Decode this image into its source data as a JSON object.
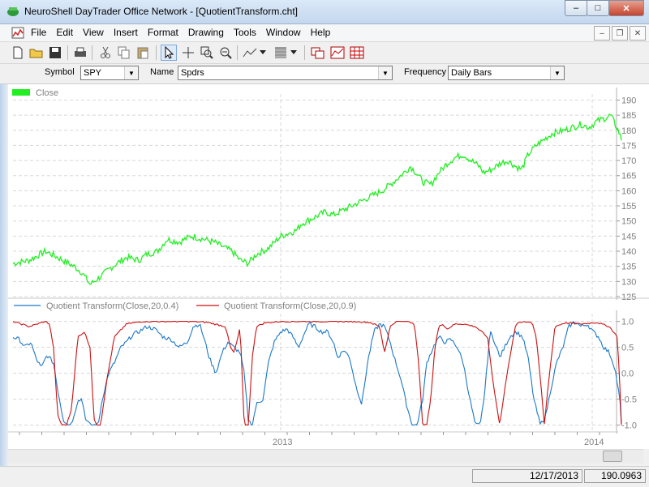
{
  "window": {
    "title": "NeuroShell DayTrader Office Network - [QuotientTransform.cht]",
    "buttons": {
      "minimize": "–",
      "maximize": "□",
      "close": "✕"
    }
  },
  "menu": {
    "items": [
      "File",
      "Edit",
      "View",
      "Insert",
      "Format",
      "Drawing",
      "Tools",
      "Window",
      "Help"
    ]
  },
  "toolbar": {
    "icons": [
      "new-icon",
      "open-icon",
      "save-icon",
      "print-icon",
      "cut-icon",
      "copy-icon",
      "paste-icon",
      "pointer-icon",
      "crosshair-icon",
      "zoom-in-icon",
      "zoom-out-icon",
      "line-tool-icon",
      "fill-pattern-icon",
      "chart-window-icon",
      "indicator-icon",
      "grid-icon"
    ]
  },
  "selectors": {
    "symbol_label": "Symbol",
    "symbol_value": "SPY",
    "name_label": "Name",
    "name_value": "Spdrs",
    "frequency_label": "Frequency",
    "frequency_value": "Daily Bars"
  },
  "status": {
    "date": "12/17/2013",
    "value": "190.0963"
  },
  "colors": {
    "price": "#22ee22",
    "qt1": "#1b78c8",
    "qt2": "#cc1111",
    "grid": "#d8d8d8"
  },
  "chart_data": [
    {
      "type": "line",
      "title": "",
      "series": [
        {
          "name": "Close",
          "anchors_x": [
            0,
            20,
            40,
            55,
            75,
            85,
            95,
            110,
            118,
            128,
            140,
            155,
            165,
            178,
            190,
            205,
            220,
            235,
            248,
            262,
            270,
            280,
            290,
            300,
            315,
            330,
            340,
            350,
            355,
            370,
            385,
            395,
            410,
            425,
            440,
            455,
            465,
            478,
            490,
            500,
            505,
            515,
            525,
            535,
            545,
            555,
            565,
            575,
            580,
            590,
            600,
            610,
            620,
            627,
            635,
            645,
            655,
            665,
            680,
            690,
            700,
            710,
            720,
            730,
            737,
            742,
            746,
            750
          ],
          "anchors_y": [
            136,
            137,
            140,
            138,
            135,
            133,
            129,
            132,
            134,
            136,
            138,
            137,
            139,
            140,
            144,
            143,
            145,
            144,
            143,
            141,
            140,
            137,
            136,
            139,
            141,
            145,
            146,
            147,
            149,
            151,
            153,
            152,
            154,
            156,
            158,
            160,
            162,
            165,
            168,
            165,
            163,
            162,
            166,
            169,
            171,
            172,
            170,
            168,
            166,
            167,
            169,
            170,
            168,
            167,
            172,
            175,
            177,
            179,
            180,
            181,
            182,
            181,
            183,
            184,
            185,
            182,
            180,
            177
          ]
        }
      ],
      "xlabel": "",
      "ylabel": "",
      "ylim": [
        125,
        192
      ],
      "yticks": [
        120,
        125,
        130,
        135,
        140,
        145,
        150,
        155,
        160,
        165,
        170,
        175,
        180,
        185,
        190
      ],
      "legend": "top-left",
      "grid": true
    },
    {
      "type": "line",
      "title": "",
      "series": [
        {
          "name": "Quotient Transform(Close,20,0.4)",
          "anchors_x": [
            0,
            8,
            15,
            22,
            28,
            35,
            42,
            50,
            55,
            62,
            70,
            75,
            80,
            85,
            90,
            95,
            100,
            105,
            110,
            118,
            125,
            133,
            140,
            148,
            155,
            165,
            175,
            185,
            195,
            205,
            215,
            222,
            230,
            235,
            242,
            250,
            258,
            265,
            272,
            280,
            285,
            290,
            295,
            300,
            308,
            315,
            322,
            330,
            338,
            345,
            352,
            360,
            365,
            372,
            380,
            388,
            395,
            400,
            408,
            415,
            422,
            430,
            437,
            445,
            452,
            458,
            465,
            470,
            478,
            485,
            492,
            498,
            505,
            510,
            518,
            525,
            532,
            540,
            548,
            555,
            562,
            570,
            576,
            582,
            588,
            594,
            600,
            606,
            612,
            620,
            628,
            635,
            642,
            650,
            657,
            663,
            670,
            678,
            685,
            693,
            700,
            708,
            715,
            722,
            728,
            735,
            742,
            748,
            750
          ],
          "anchors_y": [
            0.7,
            0.65,
            0.5,
            0.6,
            0.3,
            0.1,
            0.35,
            0.2,
            -0.3,
            -0.9,
            -1.0,
            -0.85,
            -0.5,
            -0.5,
            -0.9,
            -1.0,
            -1.0,
            -1.0,
            -0.5,
            0.0,
            0.2,
            0.5,
            0.6,
            0.75,
            0.8,
            0.9,
            0.85,
            0.7,
            0.65,
            0.5,
            0.6,
            0.9,
            0.95,
            0.7,
            0.3,
            0.0,
            0.4,
            0.6,
            0.5,
            0.4,
            0.0,
            -0.9,
            -1.0,
            -0.6,
            -0.5,
            0.2,
            0.6,
            0.8,
            0.85,
            0.7,
            0.5,
            0.8,
            0.95,
            0.9,
            0.8,
            0.8,
            0.6,
            0.3,
            0.45,
            0.3,
            -0.2,
            -0.6,
            0.2,
            0.8,
            0.95,
            0.9,
            0.6,
            0.3,
            -0.1,
            -0.6,
            -1.0,
            -1.0,
            -0.5,
            0.2,
            0.5,
            0.7,
            0.6,
            0.65,
            0.5,
            0.2,
            -0.4,
            -1.0,
            -1.0,
            -0.3,
            0.8,
            0.6,
            0.3,
            0.5,
            0.7,
            0.8,
            0.7,
            0.3,
            -0.5,
            -1.0,
            -0.8,
            -0.3,
            0.2,
            0.5,
            0.9,
            1.0,
            0.9,
            0.95,
            0.8,
            0.7,
            0.5,
            0.4,
            0.1,
            -0.5,
            -1.0
          ]
        },
        {
          "name": "Quotient Transform(Close,20,0.9)",
          "anchors_x": [
            0,
            10,
            20,
            30,
            40,
            45,
            50,
            55,
            60,
            66,
            72,
            80,
            88,
            95,
            100,
            104,
            108,
            115,
            125,
            140,
            160,
            180,
            200,
            220,
            240,
            262,
            268,
            272,
            276,
            280,
            285,
            290,
            295,
            300,
            310,
            330,
            350,
            380,
            400,
            420,
            440,
            452,
            458,
            465,
            472,
            480,
            488,
            495,
            500,
            505,
            510,
            515,
            520,
            525,
            530,
            535,
            545,
            555,
            570,
            585,
            592,
            600,
            610,
            620,
            630,
            640,
            645,
            650,
            655,
            660,
            668,
            680,
            700,
            720,
            735,
            745,
            748,
            750
          ],
          "anchors_y": [
            1.0,
            0.95,
            0.9,
            0.95,
            1.0,
            0.95,
            0.5,
            -0.8,
            -1.0,
            -1.0,
            -0.7,
            0.7,
            0.8,
            0.5,
            -0.9,
            -1.0,
            -1.0,
            -0.2,
            0.7,
            0.95,
            1.0,
            1.0,
            1.0,
            1.0,
            0.98,
            0.9,
            0.5,
            0.4,
            0.6,
            0.9,
            -1.0,
            -1.0,
            0.3,
            0.9,
            0.97,
            1.0,
            1.0,
            1.0,
            1.0,
            1.0,
            0.98,
            0.9,
            0.4,
            0.9,
            1.0,
            1.0,
            1.0,
            0.95,
            0.2,
            -1.0,
            -1.0,
            -0.5,
            0.5,
            0.9,
            0.95,
            0.85,
            0.95,
            0.95,
            0.9,
            0.7,
            -0.2,
            -1.0,
            0.1,
            0.95,
            1.0,
            0.98,
            0.7,
            -0.1,
            -1.0,
            -0.2,
            0.9,
            0.97,
            0.95,
            0.98,
            0.9,
            0.7,
            -0.2,
            -1.0
          ]
        }
      ],
      "xlabel": "",
      "ylabel": "",
      "ylim": [
        -1.1,
        1.15
      ],
      "yticks": [
        -1.0,
        -0.5,
        0.0,
        0.5,
        1.0
      ],
      "ytick_labels": [
        "-1.0",
        "-0.5",
        "0.0",
        "0.5",
        "1.0"
      ],
      "legend": "top-left",
      "grid": true
    }
  ],
  "x_axis": {
    "labels": [
      "2013",
      "2014"
    ]
  }
}
